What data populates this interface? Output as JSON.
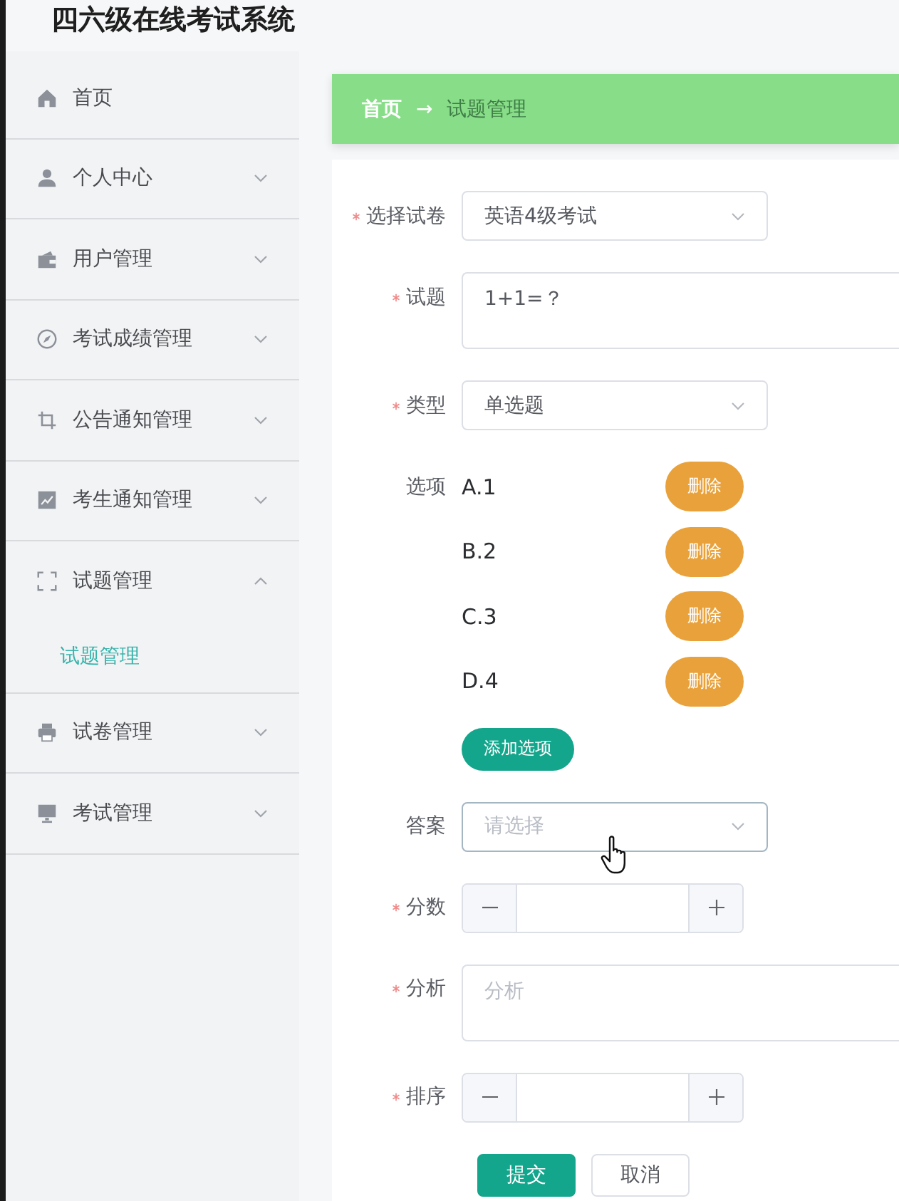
{
  "app_title": "四六级在线考试系统",
  "sidebar": {
    "items": [
      {
        "label": "首页",
        "kind": "link",
        "selected": false
      },
      {
        "label": "个人中心",
        "kind": "submenu",
        "selected": false,
        "expanded": false
      },
      {
        "label": "用户管理",
        "kind": "submenu",
        "selected": false,
        "expanded": false
      },
      {
        "label": "考试成绩管理",
        "kind": "submenu",
        "selected": false,
        "expanded": false
      },
      {
        "label": "公告通知管理",
        "kind": "submenu",
        "selected": false,
        "expanded": false
      },
      {
        "label": "考生通知管理",
        "kind": "submenu",
        "selected": false,
        "expanded": false
      },
      {
        "label": "试题管理",
        "kind": "submenu",
        "selected": false,
        "expanded": true,
        "children": [
          {
            "label": "试题管理",
            "selected": true
          }
        ]
      },
      {
        "label": "试卷管理",
        "kind": "submenu",
        "selected": false,
        "expanded": false
      },
      {
        "label": "考试管理",
        "kind": "submenu",
        "selected": false,
        "expanded": false
      }
    ]
  },
  "breadcrumb": {
    "separator": "→",
    "items": [
      {
        "label": "首页",
        "current": false
      },
      {
        "label": "试题管理",
        "current": true
      }
    ]
  },
  "form": {
    "fields": [
      {
        "kind": "select",
        "label": "选择试卷",
        "required": true,
        "value": "英语4级考试",
        "hovered": false
      },
      {
        "kind": "textarea",
        "label": "试题",
        "required": true,
        "value": "1+1=？"
      },
      {
        "kind": "select",
        "label": "类型",
        "required": true,
        "value": "单选题",
        "hovered": false
      },
      {
        "kind": "options",
        "label": "选项",
        "required": false,
        "options": [
          {
            "text": "A.1",
            "delete_label": "删除"
          },
          {
            "text": "B.2",
            "delete_label": "删除"
          },
          {
            "text": "C.3",
            "delete_label": "删除"
          },
          {
            "text": "D.4",
            "delete_label": "删除"
          }
        ],
        "add_label": "添加选项"
      },
      {
        "kind": "select",
        "label": "答案",
        "required": false,
        "placeholder": "请选择",
        "hovered": true
      },
      {
        "kind": "number",
        "label": "分数",
        "required": true
      },
      {
        "kind": "textarea",
        "label": "分析",
        "required": true,
        "placeholder": "分析"
      },
      {
        "kind": "number",
        "label": "排序",
        "required": true
      }
    ],
    "buttons": [
      {
        "label": "提交",
        "kind": "primary"
      },
      {
        "label": "取消",
        "kind": "default"
      }
    ]
  }
}
